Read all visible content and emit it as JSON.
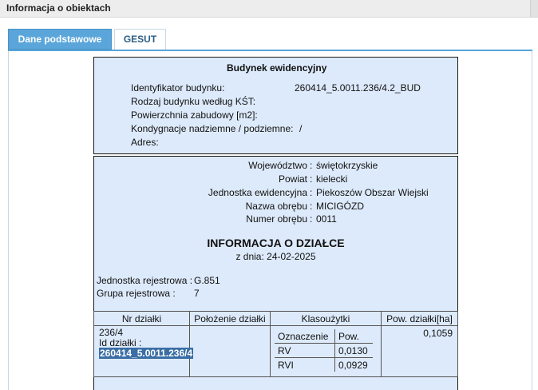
{
  "window": {
    "title": "Informacja o obiektach"
  },
  "tabs": [
    {
      "label": "Dane podstawowe",
      "active": true
    },
    {
      "label": "GESUT",
      "active": false
    }
  ],
  "building": {
    "header": "Budynek ewidencyjny",
    "fields": [
      {
        "label": "Identyfikator budynku:",
        "value": "260414_5.0011.236/4.2_BUD"
      },
      {
        "label": "Rodzaj budynku według KŚT:",
        "value": ""
      },
      {
        "label": "Powierzchnia zabudowy [m2]:",
        "value": ""
      },
      {
        "label": "Kondygnacje nadziemne / podziemne:",
        "value": "/"
      },
      {
        "label": "Adres:",
        "value": ""
      }
    ]
  },
  "location": {
    "fields": [
      {
        "label": "Województwo",
        "value": "świętokrzyskie"
      },
      {
        "label": "Powiat",
        "value": "kielecki"
      },
      {
        "label": "Jednostka ewidencyjna",
        "value": "Piekoszów Obszar Wiejski"
      },
      {
        "label": "Nazwa obrębu",
        "value": "MICIGÓZD"
      },
      {
        "label": "Numer obrębu",
        "value": "0011"
      }
    ],
    "separator": ":"
  },
  "parcel_info": {
    "title": "INFORMACJA O DZIAŁCE",
    "date": "z dnia: 24-02-2025",
    "unit_label": "Jednostka rejestrowa :",
    "unit_value": "G.851",
    "group_label": "Grupa rejestrowa :",
    "group_value": "7"
  },
  "parcel_table": {
    "headers": [
      "Nr działki",
      "Położenie działki",
      "Klasoużytki",
      "Pow. działki[ha]"
    ],
    "row": {
      "nr": "236/4",
      "id_label": "Id działki :",
      "id_value": "260414_5.0011.236/4",
      "polozenie": "",
      "area": "0,1059"
    },
    "klasy_headers": [
      "Oznaczenie",
      "Pow."
    ],
    "klasy_rows": [
      {
        "oznaczenie": "RV",
        "pow": "0,0130"
      },
      {
        "oznaczenie": "RVI",
        "pow": "0,0929"
      }
    ]
  }
}
